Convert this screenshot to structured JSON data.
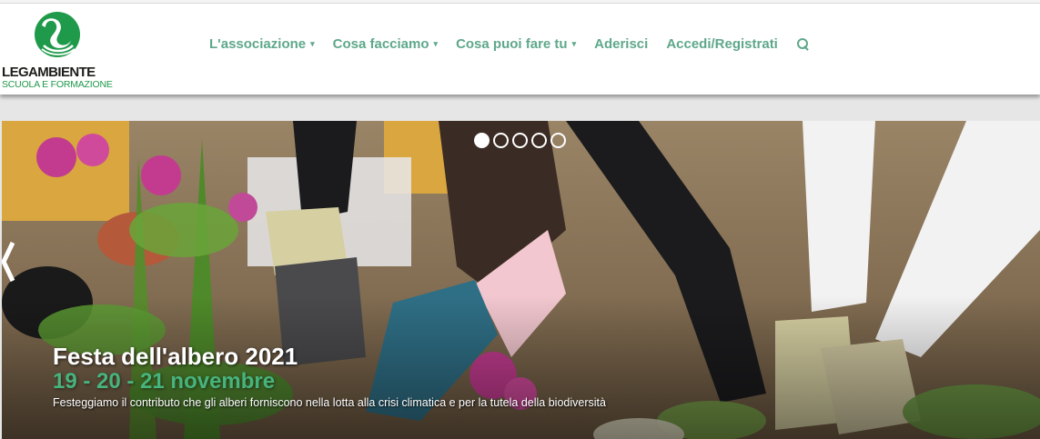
{
  "brand": {
    "name": "LEGAMBIENTE",
    "subtitle": "SCUOLA E FORMAZIONE",
    "logo_icon": "swan-logo-icon",
    "color": "#1f9a4a"
  },
  "nav": {
    "items": [
      {
        "label": "L'associazione",
        "has_dropdown": true
      },
      {
        "label": "Cosa facciamo",
        "has_dropdown": true
      },
      {
        "label": "Cosa puoi fare tu",
        "has_dropdown": true
      },
      {
        "label": "Aderisci",
        "has_dropdown": false
      },
      {
        "label": "Accedi/Registrati",
        "has_dropdown": false
      }
    ],
    "caret_glyph": "▾",
    "search_icon": "search-icon",
    "color": "#5ea88a"
  },
  "slider": {
    "slide_count": 5,
    "active_index": 0,
    "prev_icon": "chevron-left-icon",
    "title": "Festa dell'albero 2021",
    "date": "19 - 20 - 21 novembre",
    "text": "Festeggiamo il contributo che gli alberi forniscono nella lotta alla crisi climatica e per la tutela della biodiversità",
    "accent_color": "#47b37d"
  }
}
